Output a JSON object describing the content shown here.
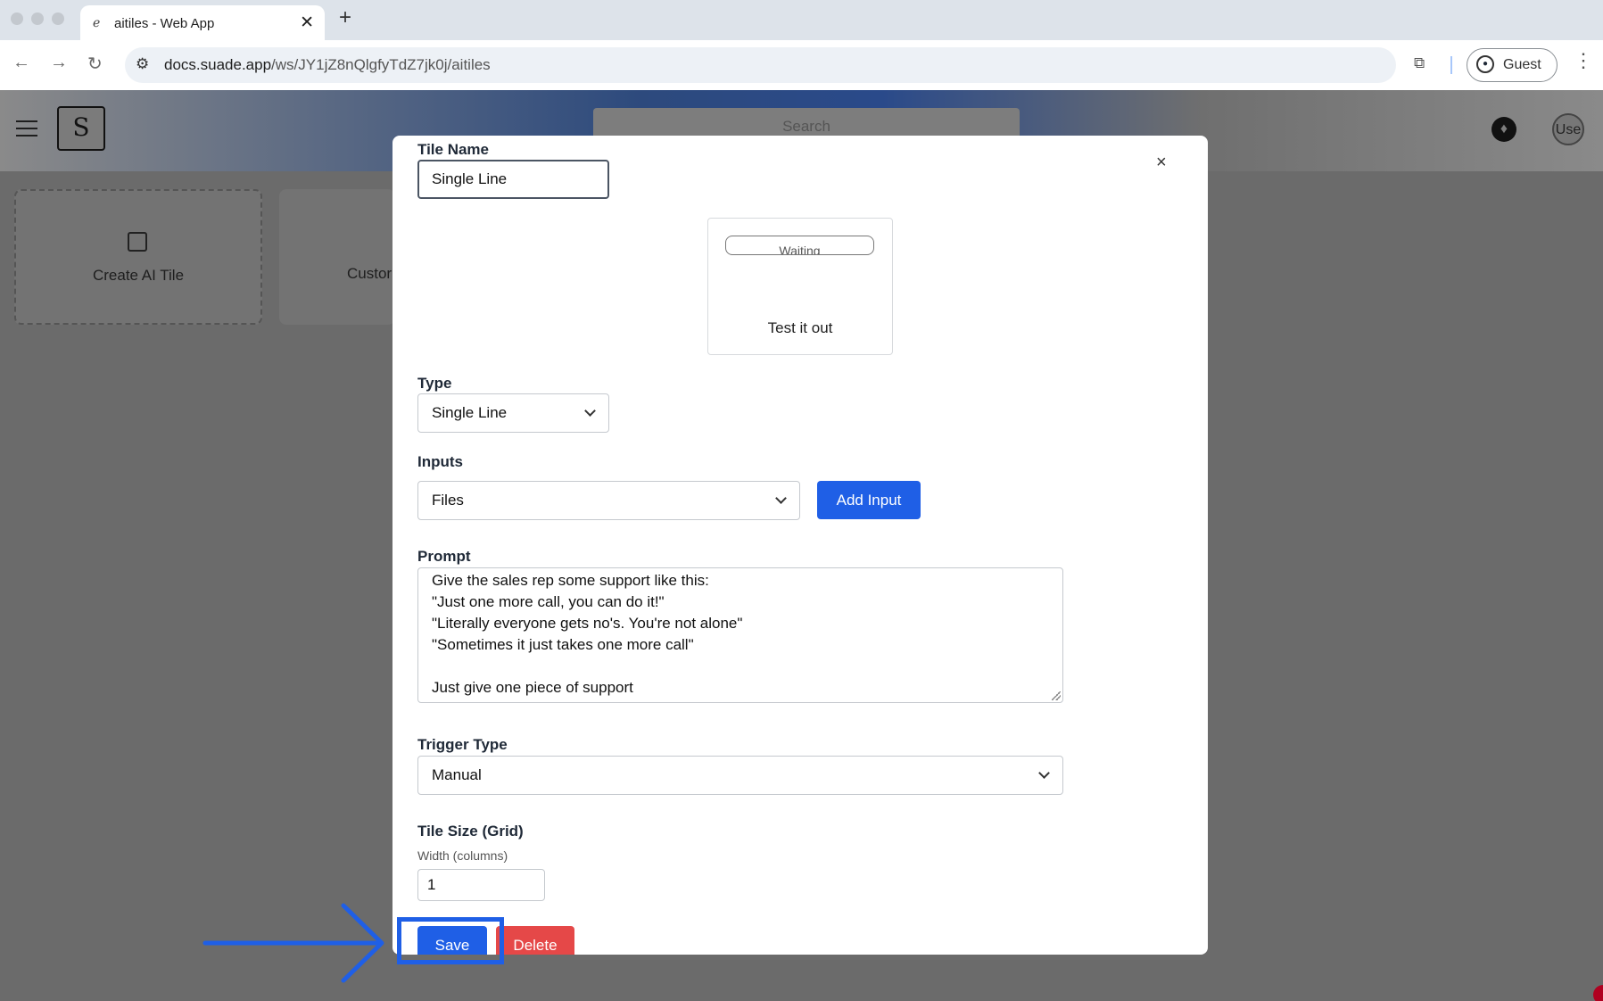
{
  "browser": {
    "tab_title": "aitiles - Web App",
    "tab_favicon": "link-icon",
    "tab_close": "✕",
    "new_tab": "+",
    "url_domain": "docs.suade.app",
    "url_path": "/ws/JY1jZ8nQlgfyTdZ7jk0j/aitiles",
    "profile_label": "Guest"
  },
  "app": {
    "logo_glyph": "S",
    "search_placeholder": "Search",
    "avatar_text": "Use",
    "cards": {
      "create_label": "Create AI Tile",
      "custom_label": "Custor"
    }
  },
  "modal": {
    "close_glyph": "×",
    "tile_name_label": "Tile Name",
    "tile_name_value": "Single Line",
    "preview_status": "Waiting",
    "preview_label": "Test it out",
    "type_label": "Type",
    "type_value": "Single Line",
    "inputs_label": "Inputs",
    "inputs_value": "Files",
    "add_input_label": "Add Input",
    "prompt_label": "Prompt",
    "prompt_lines": [
      "Give the sales rep some support like this:",
      "\"Just one more call, you can do it!\"",
      "\"Literally everyone gets no's. You're not alone\"",
      "\"Sometimes it just takes one more call\"",
      "",
      "Just give one piece of support"
    ],
    "trigger_label": "Trigger Type",
    "trigger_value": "Manual",
    "tile_size_label": "Tile Size (Grid)",
    "width_label": "Width (columns)",
    "width_value": "1",
    "save_label": "Save",
    "delete_label": "Delete"
  },
  "annotation": {
    "highlight_color": "#1f5fe6"
  }
}
